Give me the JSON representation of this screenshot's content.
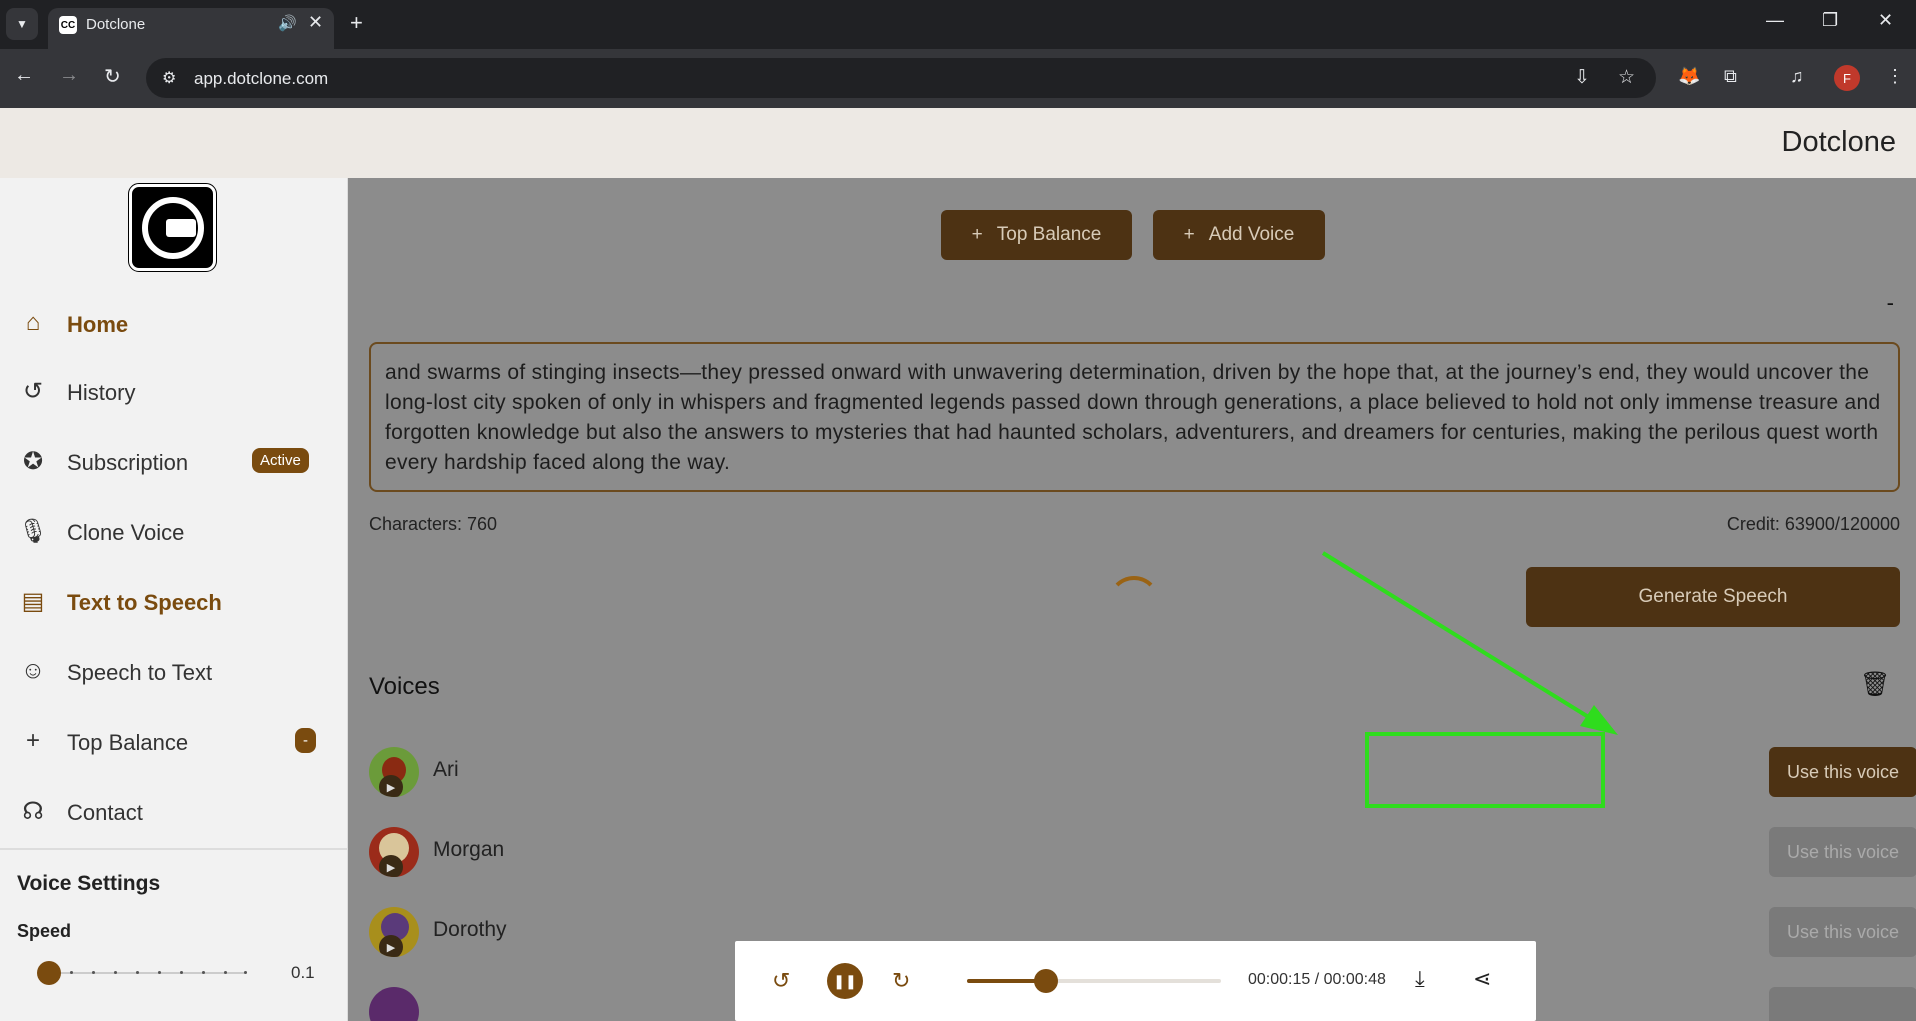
{
  "browser": {
    "tab_title": "Dotclone",
    "url": "app.dotclone.com",
    "profile_initial": "F"
  },
  "header": {
    "brand": "Dotclone"
  },
  "sidebar": {
    "items": [
      {
        "label": "Home",
        "icon": "home-icon"
      },
      {
        "label": "History",
        "icon": "history-icon"
      },
      {
        "label": "Subscription",
        "icon": "badge-icon",
        "badge": "Active"
      },
      {
        "label": "Clone Voice",
        "icon": "microphone-icon"
      },
      {
        "label": "Text to Speech",
        "icon": "document-icon"
      },
      {
        "label": "Speech to Text",
        "icon": "speaking-person-icon"
      },
      {
        "label": "Top Balance",
        "icon": "plus-icon",
        "badge": "-"
      },
      {
        "label": "Contact",
        "icon": "headset-icon"
      }
    ],
    "active_item": "Text to Speech",
    "voice_settings": {
      "title": "Voice Settings",
      "speed_label": "Speed",
      "speed_value": "0.1"
    }
  },
  "main": {
    "top_balance_button": "Top Balance",
    "add_voice_button": "Add Voice",
    "collapse_dash": "-",
    "text_input": "and swarms of stinging insects—they pressed onward with unwavering determination, driven by the hope that, at the journey’s end, they would uncover the long-lost city spoken of only in whispers and fragmented legends passed down through generations, a place believed to hold not only immense treasure and forgotten knowledge but also the answers to mysteries that had haunted scholars, adventurers, and dreamers for centuries, making the perilous quest worth every hardship faced along the way.",
    "characters": "Characters: 760",
    "credit": "Credit: 63900/120000",
    "generate_button": "Generate Speech",
    "voices_title": "Voices",
    "voices": [
      {
        "name": "Ari",
        "button": "Use this voice",
        "selected": true
      },
      {
        "name": "Morgan",
        "button": "Use this voice",
        "selected": false
      },
      {
        "name": "Dorothy",
        "button": "Use this voice",
        "selected": false
      }
    ]
  },
  "player": {
    "time": "00:00:15 / 00:00:48",
    "progress": 0.3125
  },
  "colors": {
    "accent": "#7a4b0f",
    "highlight": "#2fdc1d"
  }
}
